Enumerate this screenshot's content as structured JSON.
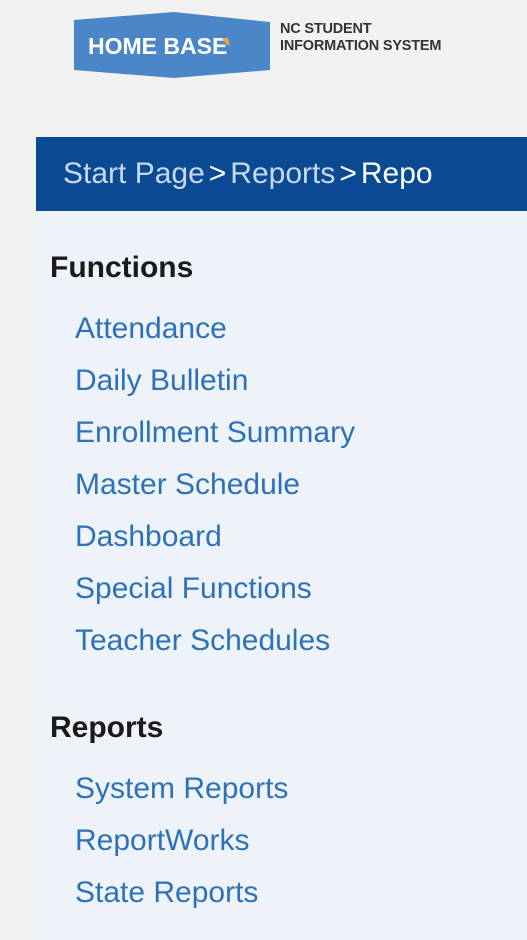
{
  "header": {
    "logo_text": "HOME BASE",
    "subtitle_line1": "NC STUDENT",
    "subtitle_line2": "INFORMATION SYSTEM"
  },
  "breadcrumb": {
    "items": [
      "Start Page",
      "Reports",
      "Repo"
    ],
    "separator": ">"
  },
  "functions": {
    "title": "Functions",
    "links": [
      "Attendance",
      "Daily Bulletin",
      "Enrollment Summary",
      "Master Schedule",
      "Dashboard",
      "Special Functions",
      "Teacher Schedules"
    ]
  },
  "reports": {
    "title": "Reports",
    "links": [
      "System Reports",
      "ReportWorks",
      "State Reports"
    ]
  },
  "colors": {
    "brand_blue": "#0a4a93",
    "logo_blue": "#4a86c8",
    "link_blue": "#2d72b8",
    "panel_bg": "#eef3f9"
  }
}
